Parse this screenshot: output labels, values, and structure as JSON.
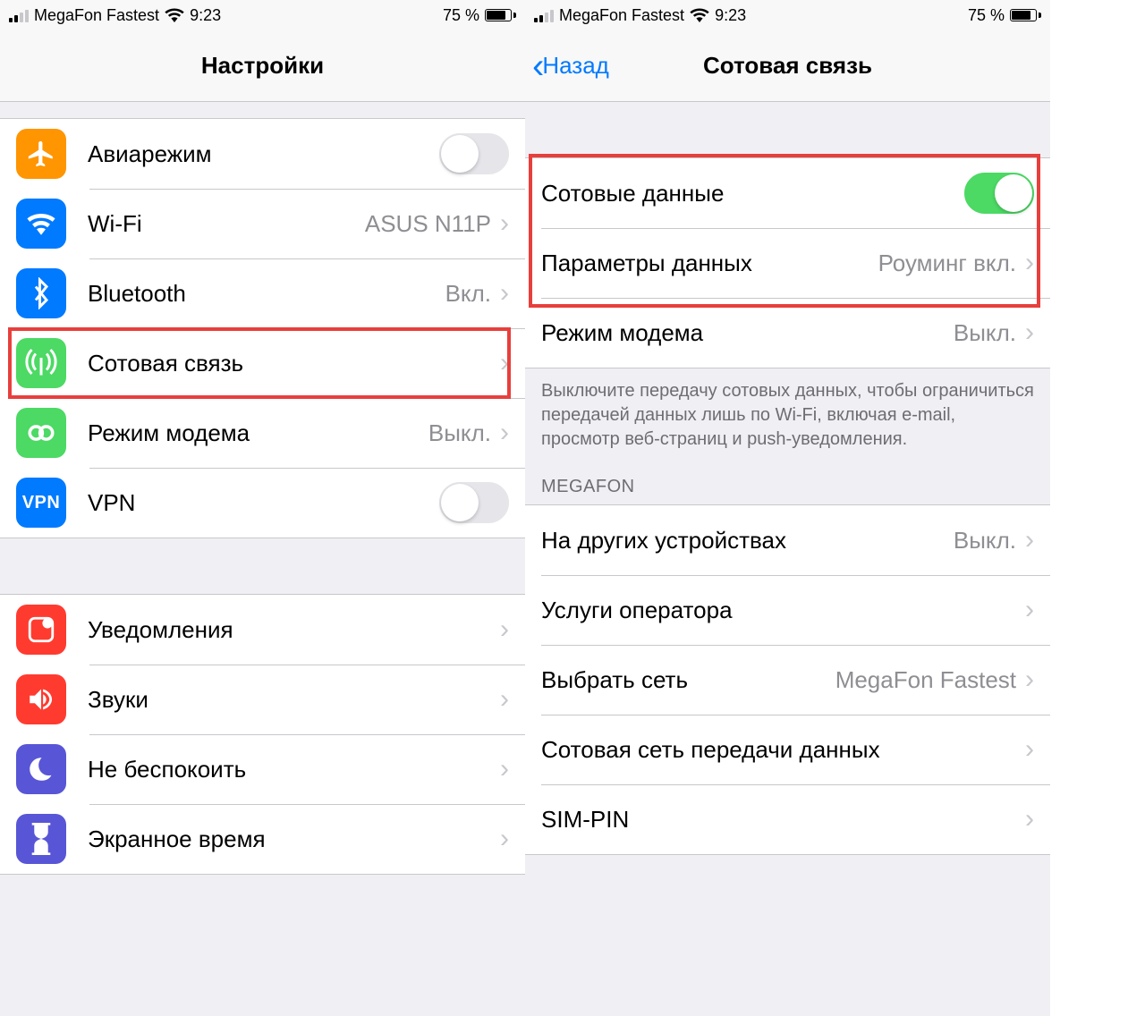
{
  "status": {
    "carrier": "MegaFon Fastest",
    "time": "9:23",
    "battery_pct": "75 %"
  },
  "left": {
    "title": "Настройки",
    "rows": {
      "airplane": "Авиарежим",
      "wifi": "Wi-Fi",
      "wifi_value": "ASUS N11P",
      "bluetooth": "Bluetooth",
      "bluetooth_value": "Вкл.",
      "cellular": "Сотовая связь",
      "hotspot": "Режим модема",
      "hotspot_value": "Выкл.",
      "vpn": "VPN",
      "vpn_badge": "VPN",
      "notifications": "Уведомления",
      "sounds": "Звуки",
      "dnd": "Не беспокоить",
      "screentime": "Экранное время"
    }
  },
  "right": {
    "back": "Назад",
    "title": "Сотовая связь",
    "cellular_data": "Сотовые данные",
    "data_options": "Параметры данных",
    "data_options_value": "Роуминг вкл.",
    "hotspot": "Режим модема",
    "hotspot_value": "Выкл.",
    "footer": "Выключите передачу сотовых данных, чтобы ограничиться передачей данных лишь по Wi-Fi, включая e-mail, просмотр веб-страниц и push-уведомления.",
    "section_header": "MEGAFON",
    "other_devices": "На других устройствах",
    "other_devices_value": "Выкл.",
    "carrier_services": "Услуги оператора",
    "network_selection": "Выбрать сеть",
    "network_selection_value": "MegaFon Fastest",
    "cellular_network": "Сотовая сеть передачи данных",
    "sim_pin": "SIM-PIN"
  }
}
